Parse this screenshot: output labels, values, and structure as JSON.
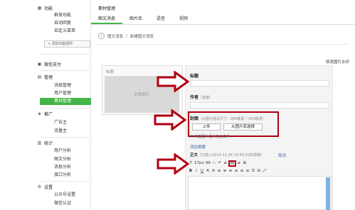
{
  "sidebar": {
    "sections": [
      {
        "title": "功能",
        "icon": "grid-icon",
        "items": [
          "群发功能",
          "自动回复",
          "自定义菜单"
        ]
      },
      {
        "title": "微信支付",
        "icon": "wechat-pay-icon",
        "items": []
      },
      {
        "title": "管理",
        "icon": "manage-icon",
        "items": [
          "消息管理",
          "用户管理",
          "素材管理"
        ]
      },
      {
        "title": "推广",
        "icon": "promote-icon",
        "items": [
          "广告主",
          "流量主"
        ]
      },
      {
        "title": "统计",
        "icon": "stats-icon",
        "items": [
          "用户分析",
          "图文分析",
          "消息分析",
          "接口分析"
        ]
      },
      {
        "title": "设置",
        "icon": "settings-icon",
        "items": [
          "公众号设置",
          "微信认证"
        ]
      }
    ],
    "add_label": "+ 添加功能插件",
    "active_item": "素材管理"
  },
  "main": {
    "title": "素材管理",
    "tabs": [
      "图文消息",
      "图片库",
      "语音",
      "视频"
    ],
    "breadcrumb": {
      "parent": "图文消息",
      "separator": "/",
      "current": "新建图文消息"
    },
    "multi_link": "修改图片水印",
    "cover_panel": {
      "label": "标题",
      "placeholder": "封面图片"
    },
    "form": {
      "title_label": "标题",
      "author_label": "作者",
      "author_hint": "（选填）",
      "cover_label": "封面",
      "cover_hint": "（大图片建议尺寸：900像素 * 500像素）",
      "upload_button": "上传",
      "library_button": "从图片库选择",
      "checkbox_label": "封面图片显示在正文中",
      "summary_link": "添加摘要",
      "body_label": "正文",
      "body_status": "（已款入2014-11-26 15:43:25的草稿）",
      "cancel_link": "取消"
    },
    "toolbar_row1": [
      "T",
      "17px",
      "99",
      "—",
      "↶",
      "≡",
      "▤",
      "≡",
      "⊞"
    ],
    "toolbar_row2": [
      "B",
      "I",
      "U",
      "A",
      "A",
      "≡",
      "≡",
      "≡",
      "≡",
      "≡",
      "≡",
      "☰",
      "⊟",
      "⤢"
    ]
  },
  "colors": {
    "accent": "#44b549",
    "annotation": "#b00010",
    "link": "#3a6ea8"
  }
}
